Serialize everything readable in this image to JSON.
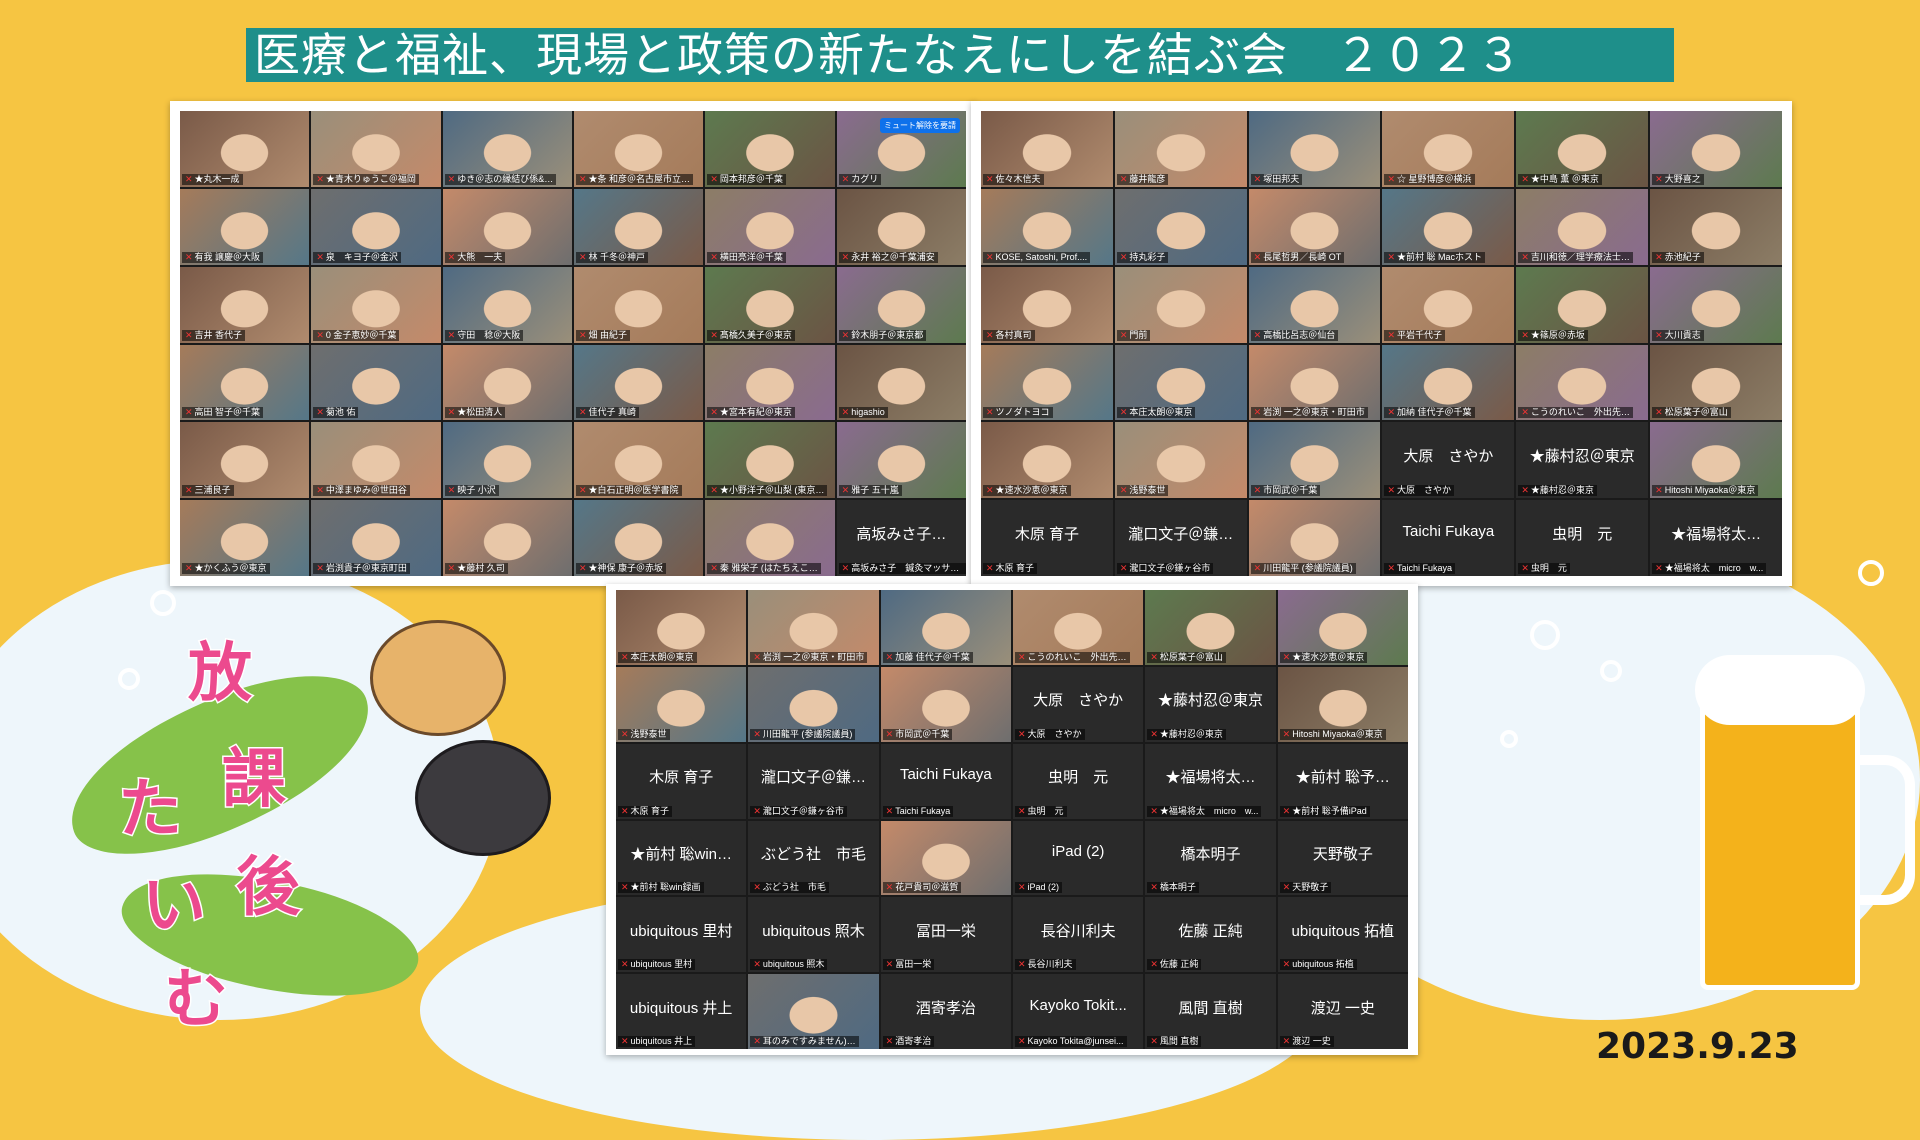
{
  "title": "医療と福祉、現場と政策の新たなえにしを結ぶ会　２０２３",
  "date": "2023.9.23",
  "houkago_chars": [
    "放",
    "課",
    "後",
    "た",
    "い",
    "む"
  ],
  "mute_button_label": "ミュート解除を要請",
  "screen1": {
    "tiles": [
      {
        "label": "★丸木一成",
        "photo": true
      },
      {
        "label": "★青木りゅうこ＠福岡",
        "photo": true
      },
      {
        "label": "ゆき＠志の縁結び係&…",
        "photo": true
      },
      {
        "label": "★条 和彦＠名古屋市立…",
        "photo": true
      },
      {
        "label": "岡本邦彦＠千葉",
        "photo": true
      },
      {
        "label": "カグリ",
        "photo": true
      },
      {
        "label": "有我 譲慶＠大阪",
        "photo": true
      },
      {
        "label": "泉　キヨ子＠金沢",
        "photo": true
      },
      {
        "label": "大熊　一夫",
        "photo": true
      },
      {
        "label": "林 千冬＠神戸",
        "photo": true
      },
      {
        "label": "横田亮洋＠千葉",
        "photo": true
      },
      {
        "label": "永井 裕之＠千葉浦安",
        "photo": true
      },
      {
        "label": "吉井 香代子",
        "photo": true
      },
      {
        "label": "0 金子恵妙＠千葉",
        "photo": true
      },
      {
        "label": "守田　稔＠大阪",
        "photo": true
      },
      {
        "label": "畑 由紀子",
        "photo": true
      },
      {
        "label": "髙橋久美子＠東京",
        "photo": true
      },
      {
        "label": "鈴木朋子＠東京都",
        "photo": true
      },
      {
        "label": "高田 智子＠千葉",
        "photo": true
      },
      {
        "label": "菊池 佑",
        "photo": true
      },
      {
        "label": "★松田清人",
        "photo": true
      },
      {
        "label": "佳代子 真崎",
        "photo": true
      },
      {
        "label": "★宮本有紀＠東京",
        "photo": true
      },
      {
        "label": "higashio",
        "photo": true
      },
      {
        "label": "三浦良子",
        "photo": true
      },
      {
        "label": "中澤まゆみ＠世田谷",
        "photo": true
      },
      {
        "label": "映子 小沢",
        "photo": true
      },
      {
        "label": "★白石正明＠医学書院",
        "photo": true
      },
      {
        "label": "★小野洋子＠山梨 (東京…",
        "photo": true
      },
      {
        "label": "雅子 五十嵐",
        "photo": true
      },
      {
        "label": "★かくふう＠東京",
        "photo": true
      },
      {
        "label": "岩渕貴子＠東京町田",
        "photo": true
      },
      {
        "label": "★藤村 久司",
        "photo": true
      },
      {
        "label": "★神保 康子＠赤坂",
        "photo": true
      },
      {
        "label": "秦 雅栄子 (はたちえこ…",
        "photo": true
      },
      {
        "label": "高坂みさ子　鍼灸マッサー…",
        "big": "高坂みさ子…",
        "photo": false
      }
    ]
  },
  "screen2": {
    "tiles": [
      {
        "label": "佐々木信夫",
        "photo": true
      },
      {
        "label": "藤井龍彦",
        "photo": true
      },
      {
        "label": "塚田邦夫",
        "photo": true
      },
      {
        "label": "☆ 星野博彦＠横浜",
        "photo": true
      },
      {
        "label": "★中島 薫 ＠東京",
        "photo": true
      },
      {
        "label": "大野喜之",
        "photo": true
      },
      {
        "label": "KOSE, Satoshi, Prof....",
        "photo": true
      },
      {
        "label": "持丸彩子",
        "photo": true
      },
      {
        "label": "長尾哲男／長崎 OT",
        "photo": true
      },
      {
        "label": "★前村 聡 Macホスト",
        "photo": true
      },
      {
        "label": "吉川和徳／理学療法士…",
        "photo": true
      },
      {
        "label": "赤池紀子",
        "photo": true
      },
      {
        "label": "各村真司",
        "photo": true
      },
      {
        "label": "門前",
        "photo": true
      },
      {
        "label": "高橋比呂志＠仙台",
        "photo": true
      },
      {
        "label": "平岩千代子",
        "photo": true
      },
      {
        "label": "★篠原＠赤坂",
        "photo": true
      },
      {
        "label": "大川貴志",
        "photo": true
      },
      {
        "label": "ツノダトヨコ",
        "photo": true
      },
      {
        "label": "本庄太朗＠東京",
        "photo": true
      },
      {
        "label": "岩渕 一之＠東京・町田市",
        "photo": true
      },
      {
        "label": "加納 佳代子＠千葉",
        "photo": true
      },
      {
        "label": "こうのれいこ　外出先…",
        "photo": true
      },
      {
        "label": "松原葉子＠富山",
        "photo": true
      },
      {
        "label": "★速水沙恵＠東京",
        "photo": true
      },
      {
        "label": "浅野泰世",
        "photo": true
      },
      {
        "label": "市岡武＠千葉",
        "photo": true
      },
      {
        "label": "大原　さやか",
        "big": "大原　さやか",
        "photo": false
      },
      {
        "label": "★藤村忍＠東京",
        "big": "★藤村忍＠東京",
        "photo": false
      },
      {
        "label": "Hitoshi Miyaoka＠東京",
        "photo": true
      },
      {
        "label": "木原 育子",
        "big": "木原 育子",
        "photo": false
      },
      {
        "label": "瀧口文子＠鎌ヶ谷市",
        "big": "瀧口文子＠鎌…",
        "photo": false
      },
      {
        "label": "川田龍平 (参議院議員)",
        "photo": true
      },
      {
        "label": "Taichi Fukaya",
        "big": "Taichi Fukaya",
        "photo": false
      },
      {
        "label": "虫明　元",
        "big": "虫明　元",
        "photo": false
      },
      {
        "label": "★福場将太　micro　w...",
        "big": "★福場将太…",
        "photo": false
      }
    ]
  },
  "screen3": {
    "tiles": [
      {
        "label": "本庄太朗＠東京",
        "photo": true
      },
      {
        "label": "岩渕 一之＠東京・町田市",
        "photo": true
      },
      {
        "label": "加藤 佳代子＠千葉",
        "photo": true
      },
      {
        "label": "こうのれいこ　外出先…",
        "photo": true
      },
      {
        "label": "松原葉子＠富山",
        "photo": true
      },
      {
        "label": "★速水沙恵＠東京",
        "photo": true
      },
      {
        "label": "浅野泰世",
        "photo": true
      },
      {
        "label": "川田龍平 (参議院議員)",
        "photo": true
      },
      {
        "label": "市岡武＠千葉",
        "photo": true
      },
      {
        "label": "大原　さやか",
        "big": "大原　さやか",
        "photo": false
      },
      {
        "label": "★藤村忍＠東京",
        "big": "★藤村忍＠東京",
        "photo": false
      },
      {
        "label": "Hitoshi Miyaoka＠東京",
        "photo": true
      },
      {
        "label": "木原 育子",
        "big": "木原 育子",
        "photo": false
      },
      {
        "label": "瀧口文子＠鎌ヶ谷市",
        "big": "瀧口文子＠鎌…",
        "photo": false
      },
      {
        "label": "Taichi Fukaya",
        "big": "Taichi Fukaya",
        "photo": false
      },
      {
        "label": "虫明　元",
        "big": "虫明　元",
        "photo": false
      },
      {
        "label": "★福場将太　micro　w...",
        "big": "★福場将太…",
        "photo": false
      },
      {
        "label": "★前村 聡予備iPad",
        "big": "★前村 聡予…",
        "photo": false
      },
      {
        "label": "★前村 聡win録画",
        "big": "★前村 聡win…",
        "photo": false
      },
      {
        "label": "ぶどう社　市毛",
        "big": "ぶどう社　市毛",
        "photo": false
      },
      {
        "label": "花戸貴司＠滋賀",
        "photo": true
      },
      {
        "label": "iPad (2)",
        "big": "iPad (2)",
        "photo": false
      },
      {
        "label": "橋本明子",
        "big": "橋本明子",
        "photo": false
      },
      {
        "label": "天野敬子",
        "big": "天野敬子",
        "photo": false
      },
      {
        "label": "ubiquitous 里村",
        "big": "ubiquitous 里村",
        "photo": false
      },
      {
        "label": "ubiquitous 照木",
        "big": "ubiquitous 照木",
        "photo": false
      },
      {
        "label": "冨田一栄",
        "big": "冨田一栄",
        "photo": false
      },
      {
        "label": "長谷川利夫",
        "big": "長谷川利夫",
        "photo": false
      },
      {
        "label": "佐藤 正純",
        "big": "佐藤 正純",
        "photo": false
      },
      {
        "label": "ubiquitous 拓植",
        "big": "ubiquitous 拓植",
        "photo": false
      },
      {
        "label": "ubiquitous 井上",
        "big": "ubiquitous 井上",
        "photo": false
      },
      {
        "label": "耳のみですみません)…",
        "photo": true
      },
      {
        "label": "酒寄孝治",
        "big": "酒寄孝治",
        "photo": false
      },
      {
        "label": "Kayoko Tokita@junsei...",
        "big": "Kayoko Tokit...",
        "photo": false
      },
      {
        "label": "風間 直樹",
        "big": "風間 直樹",
        "photo": false
      },
      {
        "label": "渡辺 一史",
        "big": "渡辺 一史",
        "photo": false
      }
    ]
  }
}
